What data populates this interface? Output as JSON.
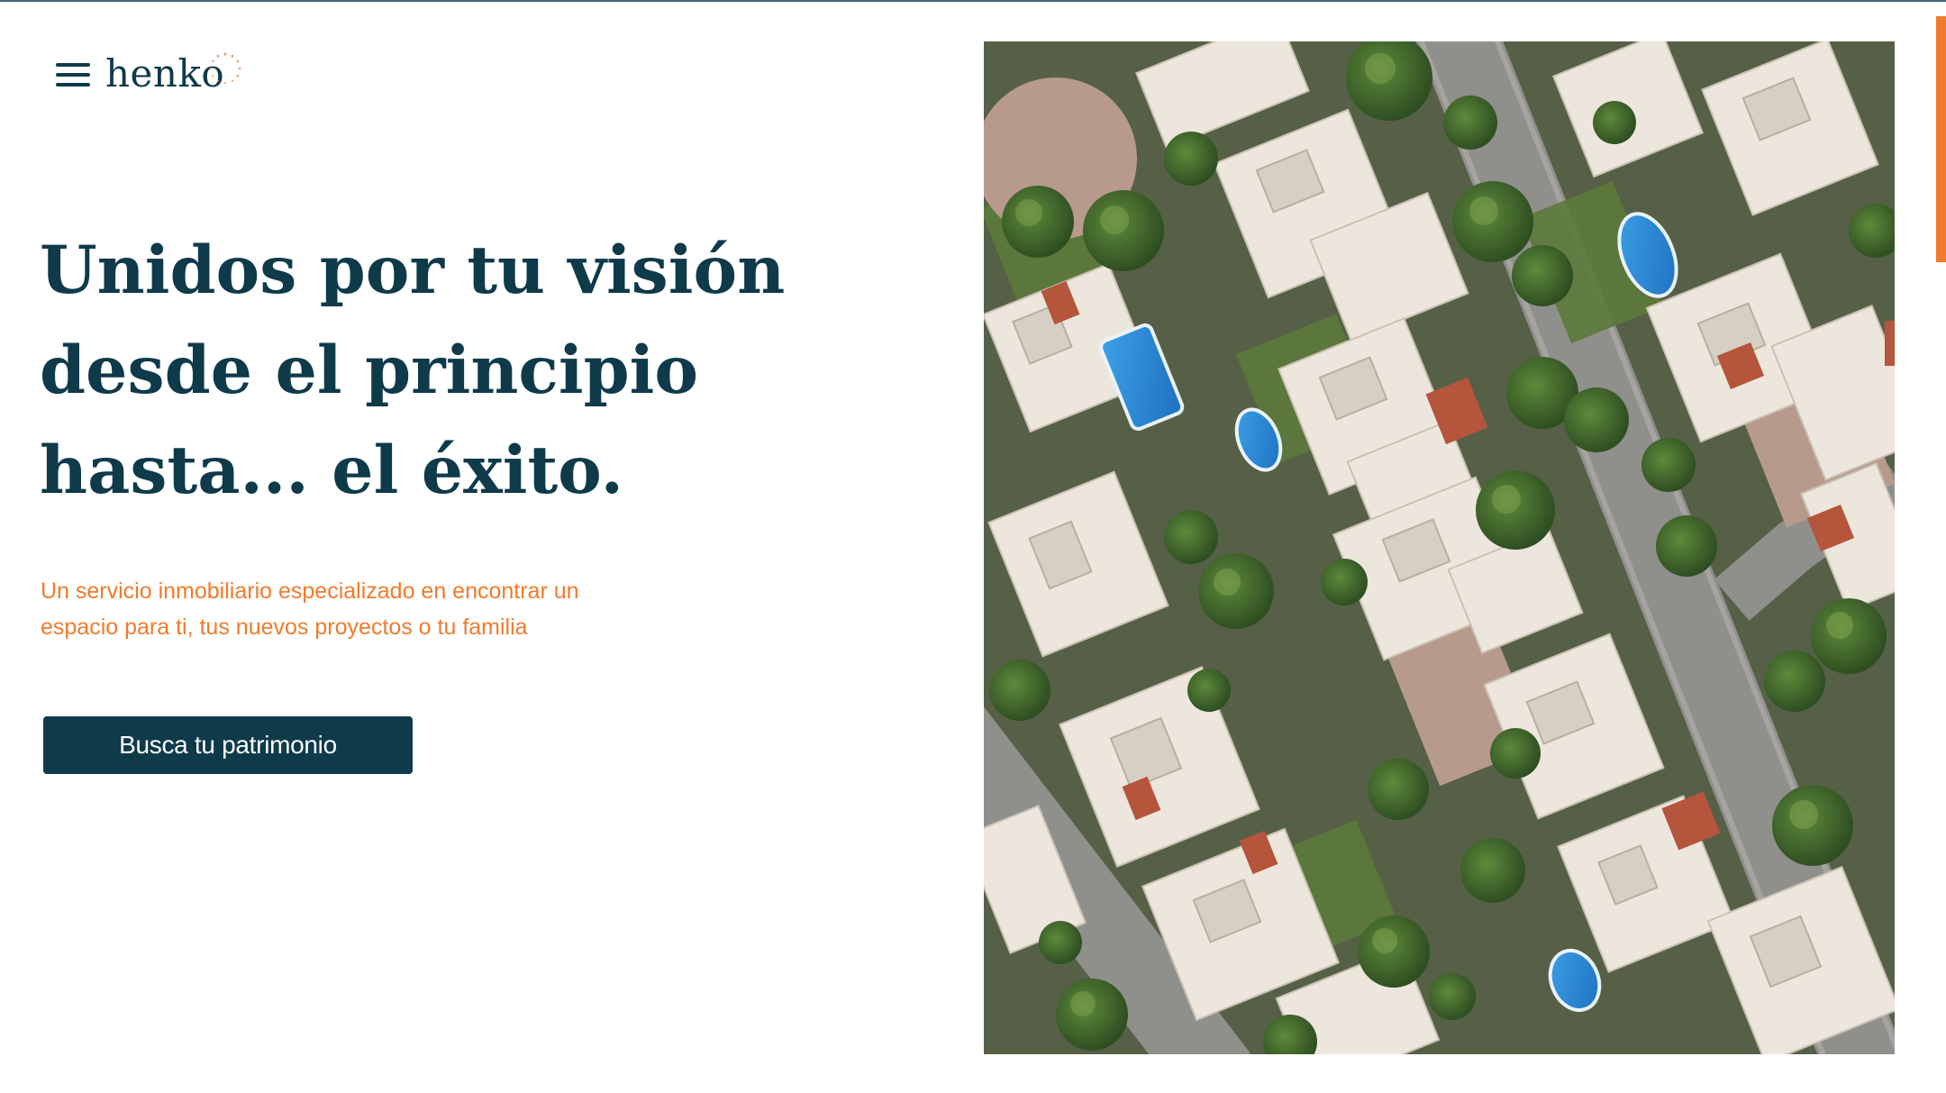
{
  "header": {
    "menu_icon": "hamburger-menu-icon",
    "logo_text": "henko",
    "logo_mark_icon": "dotted-circle-icon"
  },
  "hero": {
    "title_lines": [
      "Unidos por tu visión",
      "desde el principio",
      "hasta... el éxito."
    ],
    "subtitle_lines": [
      "Un servicio inmobiliario especializado en encontrar un",
      "espacio para ti, tus nuevos proyectos o tu familia"
    ],
    "cta_label": "Busca tu patrimonio",
    "image_subject": "aerial-residential-neighborhood-image"
  },
  "colors": {
    "primary": "#0e3a4a",
    "accent": "#f07b2c",
    "background": "#ffffff"
  }
}
